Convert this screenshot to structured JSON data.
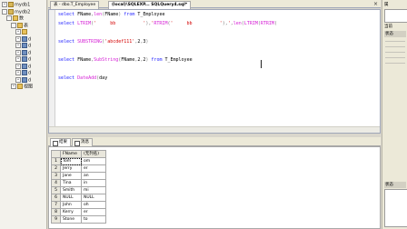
{
  "object_explorer": {
    "items": [
      {
        "label": "mydb1",
        "kind": "db",
        "pm": "+",
        "indent": 0
      },
      {
        "label": "mydb2",
        "kind": "db",
        "pm": "-",
        "indent": 0
      },
      {
        "label": "数",
        "kind": "fld",
        "pm": "-",
        "indent": 1
      },
      {
        "label": "表",
        "kind": "fld",
        "pm": "-",
        "indent": 2
      },
      {
        "label": "",
        "kind": "fld",
        "pm": "+",
        "indent": 3
      },
      {
        "label": "d",
        "kind": "tbl",
        "pm": "+",
        "indent": 3
      },
      {
        "label": "d",
        "kind": "tbl",
        "pm": "+",
        "indent": 3
      },
      {
        "label": "d",
        "kind": "tbl",
        "pm": "+",
        "indent": 3
      },
      {
        "label": "d",
        "kind": "tbl",
        "pm": "+",
        "indent": 3
      },
      {
        "label": "d",
        "kind": "tbl",
        "pm": "+",
        "indent": 3
      },
      {
        "label": "d",
        "kind": "tbl",
        "pm": "+",
        "indent": 3
      },
      {
        "label": "d",
        "kind": "tbl",
        "pm": "+",
        "indent": 3
      },
      {
        "label": "视图",
        "kind": "fld",
        "pm": "+",
        "indent": 2
      }
    ]
  },
  "tabs": [
    {
      "label": "表 - dbo.T_Employee"
    },
    {
      "label": "(local)\\SQLEXP... SQLQuery4.sql*"
    }
  ],
  "tab_close": "×",
  "editor": {
    "lines": [
      [
        [
          "kw",
          "select "
        ],
        [
          "id",
          "FName"
        ],
        [
          "gr",
          ","
        ],
        [
          "fn",
          "len"
        ],
        [
          "gr",
          "("
        ],
        [
          "id",
          "FName"
        ],
        [
          "gr",
          ") "
        ],
        [
          "kw",
          "from "
        ],
        [
          "id",
          "T_Employee"
        ]
      ],
      [
        [
          "kw",
          "select "
        ],
        [
          "fn",
          "LTRIM"
        ],
        [
          "gr",
          "("
        ],
        [
          "st",
          "'     bb          '"
        ],
        [
          "gr",
          ")"
        ],
        [
          "gr",
          ","
        ],
        [
          "st",
          "'"
        ],
        [
          "fn",
          "RTRIM"
        ],
        [
          "gr",
          "("
        ],
        [
          "st",
          "'     bb          '"
        ],
        [
          "gr",
          ")"
        ],
        [
          "gr",
          ","
        ],
        [
          "st",
          "'"
        ],
        [
          "gr",
          ","
        ],
        [
          "fn",
          "len"
        ],
        [
          "gr",
          "("
        ],
        [
          "fn",
          "LTRIM"
        ],
        [
          "gr",
          "("
        ],
        [
          "fn",
          "RTRIM"
        ],
        [
          "gr",
          "("
        ]
      ],
      [],
      [
        [
          "kw",
          "select "
        ],
        [
          "fn",
          "SUBSTRING"
        ],
        [
          "gr",
          "("
        ],
        [
          "st",
          "'abcdef111'"
        ],
        [
          "gr",
          ","
        ],
        [
          "id",
          "2"
        ],
        [
          "gr",
          ","
        ],
        [
          "id",
          "3"
        ],
        [
          "gr",
          ")"
        ]
      ],
      [],
      [
        [
          "kw",
          "select "
        ],
        [
          "id",
          "FName"
        ],
        [
          "gr",
          ","
        ],
        [
          "fn",
          "SubString"
        ],
        [
          "gr",
          "("
        ],
        [
          "id",
          "FName"
        ],
        [
          "gr",
          ","
        ],
        [
          "id",
          "2"
        ],
        [
          "gr",
          ","
        ],
        [
          "id",
          "2"
        ],
        [
          "gr",
          ") "
        ],
        [
          "kw",
          "from "
        ],
        [
          "id",
          "T_Employee"
        ]
      ],
      [],
      [
        [
          "kw",
          "select "
        ],
        [
          "fn",
          "DateAdd"
        ],
        [
          "gr",
          "("
        ],
        [
          "id",
          "day"
        ]
      ]
    ]
  },
  "results": {
    "tabs": [
      {
        "label": "结果"
      },
      {
        "label": "消息"
      }
    ],
    "columns": [
      "FName",
      "(无列名)"
    ],
    "rows": [
      {
        "n": "1",
        "c1": "Tom",
        "c2": "om"
      },
      {
        "n": "2",
        "c1": "Jerry",
        "c2": "er"
      },
      {
        "n": "3",
        "c1": "Jane",
        "c2": "an"
      },
      {
        "n": "4",
        "c1": "Tina",
        "c2": "in"
      },
      {
        "n": "5",
        "c1": "Smith",
        "c2": "mi"
      },
      {
        "n": "6",
        "c1": "NULL",
        "c2": "NULL"
      },
      {
        "n": "7",
        "c1": "John",
        "c2": "oh"
      },
      {
        "n": "8",
        "c1": "Kerry",
        "c2": "er"
      },
      {
        "n": "9",
        "c1": "Stone",
        "c2": "to"
      }
    ]
  },
  "properties": {
    "titles": [
      {
        "text": "属",
        "y": 2
      },
      {
        "text": "当前",
        "y": 26
      }
    ],
    "head1": "状态",
    "head2": "状态"
  }
}
